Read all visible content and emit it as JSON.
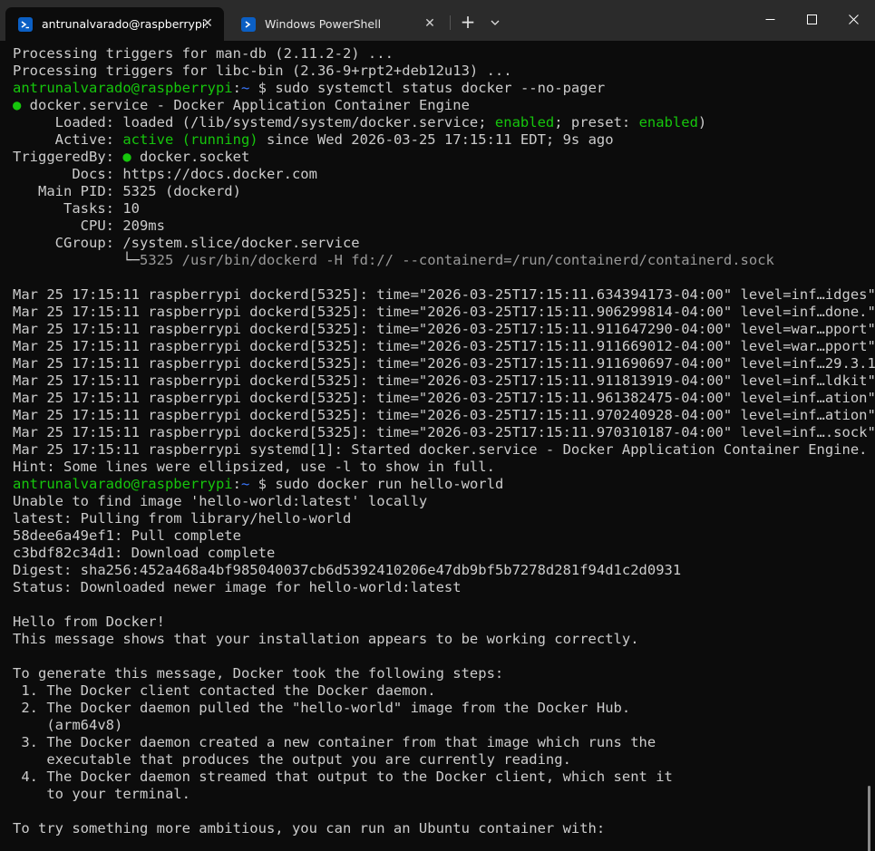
{
  "window": {
    "tabs": [
      {
        "title": "antrunalvarado@raspberrypi:",
        "active": true,
        "icon": "terminal-icon"
      },
      {
        "title": "Windows PowerShell",
        "active": false,
        "icon": "powershell-icon"
      }
    ],
    "close_glyph": "✕",
    "newtab_glyph": "+"
  },
  "colors": {
    "background": "#0c0c0c",
    "titlebar": "#2b2b2b",
    "text": "#cccccc",
    "prompt_green": "#16c60c",
    "path_blue": "#3b78ff",
    "powershell_blue": "#0b5fc4"
  },
  "terminal": {
    "lines": [
      "Processing triggers for man-db (2.11.2-2) ...",
      "Processing triggers for libc-bin (2.36-9+rpt2+deb12u13) ...",
      {
        "user": "antrunalvarado@raspberrypi",
        "colon": ":",
        "path": "~",
        "cmd": " $ sudo systemctl status docker --no-pager"
      },
      {
        "dot": "●",
        "rest": " docker.service - Docker Application Container Engine"
      },
      {
        "a": "     Loaded: loaded (/lib/systemd/system/docker.service; ",
        "g1": "enabled",
        "b": "; preset: ",
        "g2": "enabled",
        "c": ")"
      },
      {
        "a": "     Active: ",
        "g1": "active (running)",
        "b": " since Wed 2026-03-25 17:15:11 EDT; 9s ago"
      },
      {
        "a": "TriggeredBy: ",
        "dot": "●",
        "b": " docker.socket"
      },
      "       Docs: https://docs.docker.com",
      "   Main PID: 5325 (dockerd)",
      "      Tasks: 10",
      "        CPU: 209ms",
      "     CGroup: /system.slice/docker.service",
      {
        "tree": "             └─",
        "dim": "5325 /usr/bin/dockerd -H fd:// --containerd=/run/containerd/containerd.sock"
      },
      "",
      "Mar 25 17:15:11 raspberrypi dockerd[5325]: time=\"2026-03-25T17:15:11.634394173-04:00\" level=inf…idges\"",
      "Mar 25 17:15:11 raspberrypi dockerd[5325]: time=\"2026-03-25T17:15:11.906299814-04:00\" level=inf…done.\"",
      "Mar 25 17:15:11 raspberrypi dockerd[5325]: time=\"2026-03-25T17:15:11.911647290-04:00\" level=war…pport\"",
      "Mar 25 17:15:11 raspberrypi dockerd[5325]: time=\"2026-03-25T17:15:11.911669012-04:00\" level=war…pport\"",
      "Mar 25 17:15:11 raspberrypi dockerd[5325]: time=\"2026-03-25T17:15:11.911690697-04:00\" level=inf…29.3.1",
      "Mar 25 17:15:11 raspberrypi dockerd[5325]: time=\"2026-03-25T17:15:11.911813919-04:00\" level=inf…ldkit\"",
      "Mar 25 17:15:11 raspberrypi dockerd[5325]: time=\"2026-03-25T17:15:11.961382475-04:00\" level=inf…ation\"",
      "Mar 25 17:15:11 raspberrypi dockerd[5325]: time=\"2026-03-25T17:15:11.970240928-04:00\" level=inf…ation\"",
      "Mar 25 17:15:11 raspberrypi dockerd[5325]: time=\"2026-03-25T17:15:11.970310187-04:00\" level=inf….sock\"",
      "Mar 25 17:15:11 raspberrypi systemd[1]: Started docker.service - Docker Application Container Engine.",
      "Hint: Some lines were ellipsized, use -l to show in full.",
      {
        "user": "antrunalvarado@raspberrypi",
        "colon": ":",
        "path": "~",
        "cmd": " $ sudo docker run hello-world"
      },
      "Unable to find image 'hello-world:latest' locally",
      "latest: Pulling from library/hello-world",
      "58dee6a49ef1: Pull complete",
      "c3bdf82c34d1: Download complete",
      "Digest: sha256:452a468a4bf985040037cb6d5392410206e47db9bf5b7278d281f94d1c2d0931",
      "Status: Downloaded newer image for hello-world:latest",
      "",
      "Hello from Docker!",
      "This message shows that your installation appears to be working correctly.",
      "",
      "To generate this message, Docker took the following steps:",
      " 1. The Docker client contacted the Docker daemon.",
      " 2. The Docker daemon pulled the \"hello-world\" image from the Docker Hub.",
      "    (arm64v8)",
      " 3. The Docker daemon created a new container from that image which runs the",
      "    executable that produces the output you are currently reading.",
      " 4. The Docker daemon streamed that output to the Docker client, which sent it",
      "    to your terminal.",
      "",
      "To try something more ambitious, you can run an Ubuntu container with:"
    ]
  }
}
